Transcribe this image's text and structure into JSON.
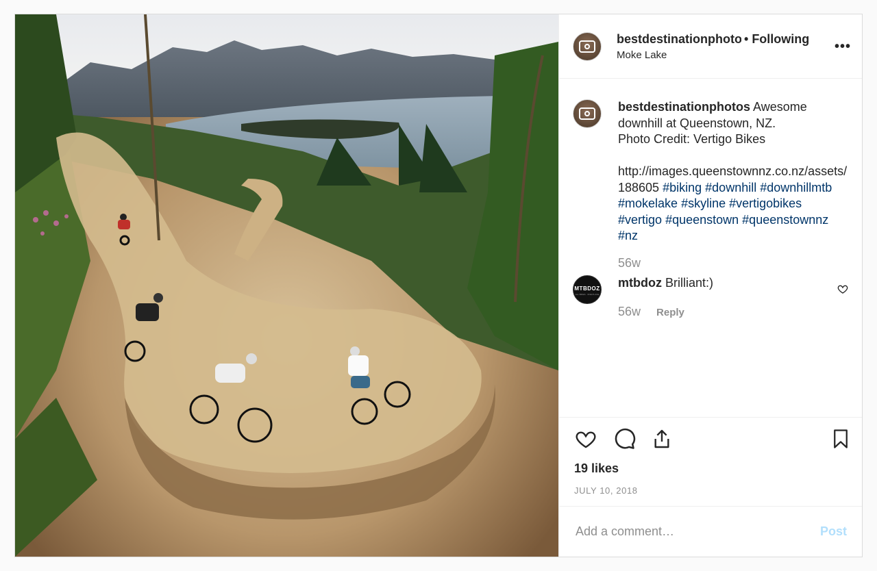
{
  "post": {
    "photo_alt": "",
    "header": {
      "username": "bestdestinationphotos",
      "dot": "•",
      "follow_label": "Following",
      "location": "Moke Lake",
      "more_label": "•••"
    },
    "caption": {
      "username": "bestdestinationphotos",
      "text_line1": " Awesome downhill at Queenstown, NZ.",
      "text_line2": "Photo Credit: Vertigo Bikes",
      "url": "http://images.queenstownnz.co.nz/assets/188605",
      "hashtags": [
        "#biking",
        "#downhill",
        "#downhillmtb",
        "#mokelake",
        "#skyline",
        "#vertigobikes",
        "#vertigo",
        "#queenstown",
        "#queenstownnz",
        "#nz"
      ],
      "age": "56w"
    },
    "comment": {
      "avatar_text": "MTBDOZ",
      "avatar_sub": "ALL BIKES · ONE PLACE",
      "username": "mtbdoz",
      "text": " Brilliant:)",
      "age": "56w",
      "reply_label": "Reply"
    },
    "likes": "19 likes",
    "date": "JULY 10, 2018",
    "add_comment_placeholder": "Add a comment…",
    "post_button": "Post"
  },
  "icons": {
    "like": "heart-icon",
    "comment": "comment-bubble-icon",
    "share": "share-upload-icon",
    "save": "bookmark-icon",
    "comment_like": "heart-icon"
  },
  "colors": {
    "hashtag": "#003569",
    "muted": "#8e8e8e",
    "post_button": "#b2dffc"
  }
}
